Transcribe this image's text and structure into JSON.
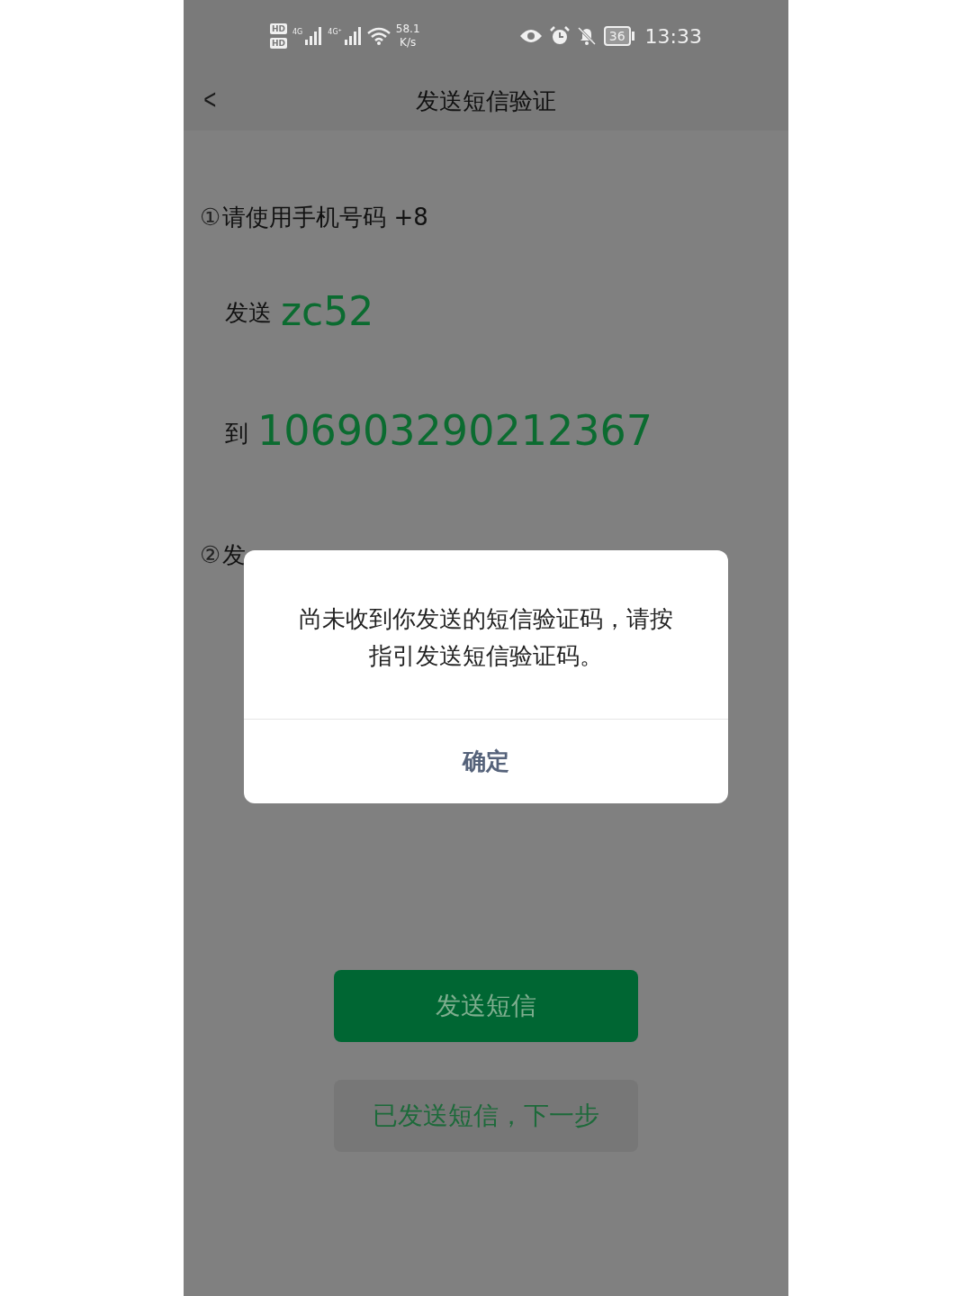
{
  "status_bar": {
    "sim_labels": [
      "HD",
      "HD"
    ],
    "network_1": "4G",
    "network_2": "4G⁺",
    "speed_value": "58.1",
    "speed_unit": "K/s",
    "battery": "36",
    "time": "13:33"
  },
  "header": {
    "back": "<",
    "title": "发送短信验证"
  },
  "steps": [
    {
      "marker": "①",
      "text": "请使用手机号码 +8"
    },
    {
      "marker": "②",
      "text": "发"
    }
  ],
  "send_line": {
    "label": "发送",
    "code": "zc52"
  },
  "to_line": {
    "label": "到",
    "number": "106903290212367"
  },
  "buttons": [
    {
      "label": "发送短信",
      "kind": "primary"
    },
    {
      "label": "已发送短信，下一步",
      "kind": "secondary"
    }
  ],
  "dialog": {
    "message": "尚未收到你发送的短信验证码，请按指引发送短信验证码。",
    "button": "确定"
  }
}
